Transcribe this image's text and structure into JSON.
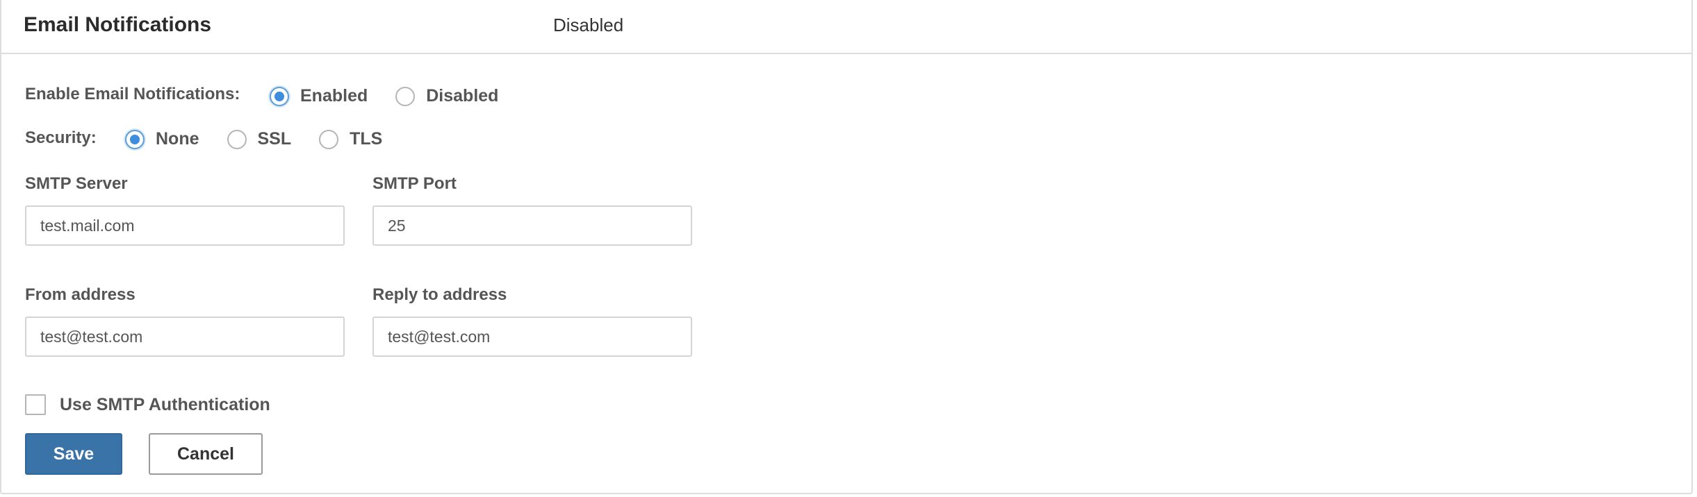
{
  "header": {
    "title": "Email Notifications",
    "status": "Disabled"
  },
  "enable_email": {
    "label": "Enable Email Notifications:",
    "options": [
      {
        "label": "Enabled",
        "checked": true
      },
      {
        "label": "Disabled",
        "checked": false
      }
    ]
  },
  "security": {
    "label": "Security:",
    "options": [
      {
        "label": "None",
        "checked": true
      },
      {
        "label": "SSL",
        "checked": false
      },
      {
        "label": "TLS",
        "checked": false
      }
    ]
  },
  "smtp_server": {
    "label": "SMTP Server",
    "value": "test.mail.com"
  },
  "smtp_port": {
    "label": "SMTP Port",
    "value": "25"
  },
  "from_address": {
    "label": "From address",
    "value": "test@test.com"
  },
  "reply_to_address": {
    "label": "Reply to address",
    "value": "test@test.com"
  },
  "smtp_auth": {
    "label": "Use SMTP Authentication",
    "checked": false
  },
  "buttons": {
    "save_label": "Save",
    "cancel_label": "Cancel"
  },
  "colors": {
    "accent": "#3f8ede",
    "primary_button": "#3a73a8",
    "border": "#d4d4d4"
  }
}
